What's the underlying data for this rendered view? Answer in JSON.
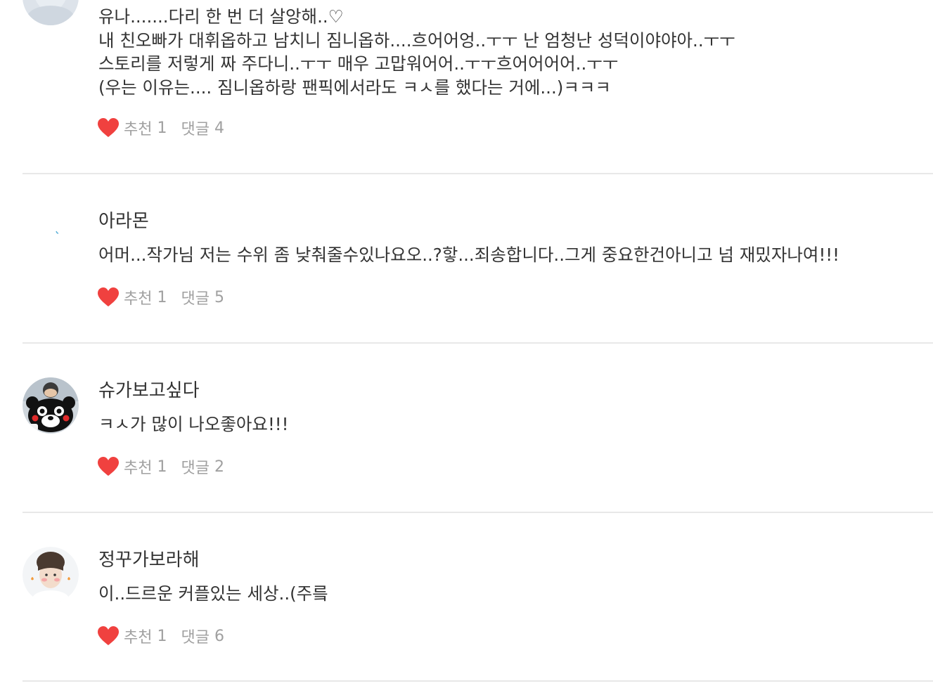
{
  "colors": {
    "heart": "#f0413f",
    "text": "#333333",
    "meta": "#a0a0a0",
    "divider": "#e8e8e8"
  },
  "comments": [
    {
      "lines": [
        "유나.......다리 한 번 더 살앙해..♡",
        "내 친오빠가 대휘옵하고 남치니 짐니옵하....흐어어엉..ㅜㅜ 난 엄청난 성덕이야야아..ㅜㅜ",
        "스토리를 저렇게 짜 주다니..ㅜㅜ 매우 고맙워어어..ㅜㅜ흐어어어어..ㅜㅜ",
        "(우는 이유는.... 짐니옵하랑 팬픽에서라도 ㅋㅅ를 했다는 거에...)ㅋㅋㅋ"
      ],
      "like_label": "추천",
      "like_count": "1",
      "reply_label": "댓글",
      "reply_count": "4",
      "avatar_icon": "avatar-photo-icon"
    },
    {
      "username": "아라몬",
      "text": "어머...작가님 저는 수위 좀 낮춰줄수있나요오..?핳...죄송합니다..그게 중요한건아니고 넘 재밌자나여!!!",
      "like_label": "추천",
      "like_count": "1",
      "reply_label": "댓글",
      "reply_count": "5",
      "avatar_icon": "avatar-blank-icon"
    },
    {
      "username": "슈가보고싶다",
      "text": "ㅋㅅ가 많이 나오좋아요!!!",
      "like_label": "추천",
      "like_count": "1",
      "reply_label": "댓글",
      "reply_count": "2",
      "avatar_icon": "avatar-bear-mascot-icon"
    },
    {
      "username": "정꾸가보라해",
      "text": "이..드르운 커플있는 세상..(주릌",
      "like_label": "추천",
      "like_count": "1",
      "reply_label": "댓글",
      "reply_count": "6",
      "avatar_icon": "avatar-photo-icon"
    }
  ]
}
